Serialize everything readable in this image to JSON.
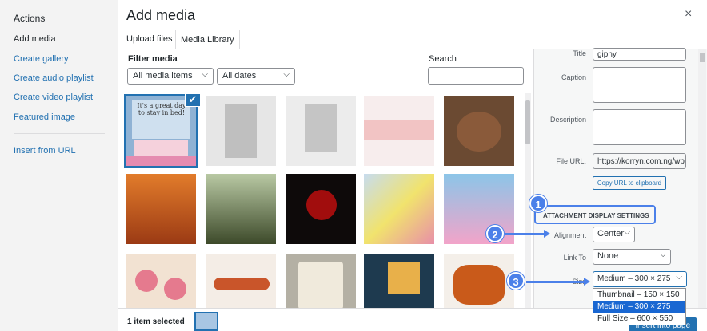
{
  "sidebar": {
    "title": "Actions",
    "items": [
      {
        "label": "Add media"
      },
      {
        "label": "Create gallery"
      },
      {
        "label": "Create audio playlist"
      },
      {
        "label": "Create video playlist"
      },
      {
        "label": "Featured image"
      },
      {
        "label": "Insert from URL"
      }
    ]
  },
  "header": {
    "title": "Add media",
    "close_glyph": "×"
  },
  "tabs": [
    {
      "label": "Upload files"
    },
    {
      "label": "Media Library"
    }
  ],
  "filter": {
    "label": "Filter media",
    "type_value": "All media items",
    "date_value": "All dates",
    "search_label": "Search",
    "search_value": ""
  },
  "media_grid": {
    "items": [
      {
        "name": "giphy",
        "selected": true,
        "text": "It's a great day to stay in bed!",
        "color": "#8fb2d4"
      },
      {
        "name": "blurred-1",
        "color": "#cfcfcf"
      },
      {
        "name": "blurred-2",
        "color": "#d6d6d6"
      },
      {
        "name": "blurred-3",
        "color": "#f0c9c9"
      },
      {
        "name": "cookie",
        "color": "#6b4a32"
      },
      {
        "name": "autumn-trees",
        "color": "#d2691e"
      },
      {
        "name": "forest-road",
        "color": "#5a6b3a"
      },
      {
        "name": "red-rose",
        "color": "#8b0000"
      },
      {
        "name": "yellow-flowers",
        "color": "#e8d36b"
      },
      {
        "name": "pink-flower",
        "color": "#e890b5"
      },
      {
        "name": "heart-toasts",
        "color": "#e8a0a0"
      },
      {
        "name": "sausages",
        "color": "#c9552a"
      },
      {
        "name": "snack-star",
        "color": "#f2c200"
      },
      {
        "name": "fries",
        "color": "#1e3a4f"
      },
      {
        "name": "wings",
        "color": "#c95a1a"
      }
    ]
  },
  "bottom": {
    "selected_count": "1 item selected",
    "insert_label": "insert into page"
  },
  "details": {
    "title_label": "Title",
    "title_value": "giphy",
    "caption_label": "Caption",
    "description_label": "Description",
    "file_url_label": "File URL:",
    "file_url_value": "https://korryn.com.ng/wp",
    "copy_label": "Copy URL to clipboard"
  },
  "display_settings": {
    "heading": "ATTACHMENT DISPLAY SETTINGS",
    "alignment_label": "Alignment",
    "alignment_value": "Center",
    "link_to_label": "Link To",
    "link_to_value": "None",
    "size_label": "Size",
    "size_value": "Medium – 300 × 275",
    "size_options": [
      {
        "label": "Thumbnail – 150 × 150",
        "highlighted": false
      },
      {
        "label": "Medium – 300 × 275",
        "highlighted": true
      },
      {
        "label": "Full Size – 600 × 550",
        "highlighted": false
      }
    ]
  },
  "annotations": [
    {
      "label": "1"
    },
    {
      "label": "2"
    },
    {
      "label": "3"
    }
  ],
  "colors": {
    "accent": "#2271b1",
    "callout": "#4b80e9",
    "highlight": "#1967d2"
  }
}
